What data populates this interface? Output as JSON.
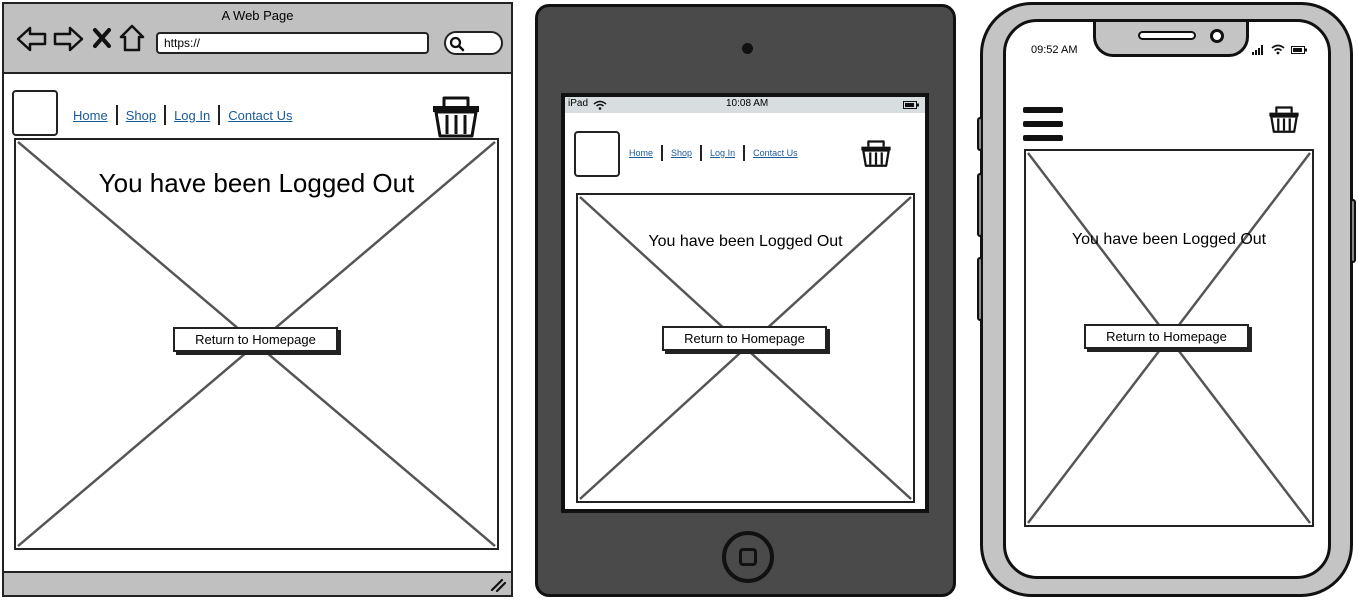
{
  "browser": {
    "window_title": "A Web Page",
    "url": "https://",
    "nav": [
      "Home",
      "Shop",
      "Log In",
      "Contact Us"
    ],
    "heading": "You have been Logged Out",
    "button": "Return to Homepage",
    "icons": [
      "back-arrow-icon",
      "forward-arrow-icon",
      "close-icon",
      "home-icon",
      "search-icon",
      "basket-icon",
      "resize-grip-icon"
    ]
  },
  "tablet": {
    "status_carrier": "iPad",
    "status_time": "10:08 AM",
    "nav": [
      "Home",
      "Shop",
      "Log In",
      "Contact Us"
    ],
    "heading": "You have been Logged Out",
    "button": "Return to Homepage",
    "icons": [
      "wifi-icon",
      "battery-icon",
      "basket-icon",
      "home-button-icon"
    ]
  },
  "phone": {
    "status_time": "09:52 AM",
    "heading": "You have been Logged Out",
    "button": "Return to Homepage",
    "icons": [
      "signal-icon",
      "wifi-icon",
      "battery-icon",
      "hamburger-menu-icon",
      "basket-icon"
    ]
  },
  "colors": {
    "link": "#1a5a9a",
    "chrome": "#c0c0c0",
    "tablet_body": "#4a4a4a",
    "phone_body": "#c4c4c4"
  }
}
